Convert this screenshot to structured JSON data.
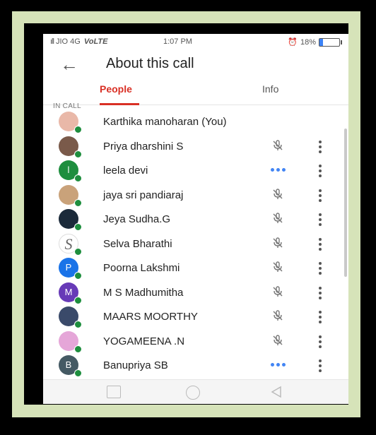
{
  "status_bar": {
    "carrier": "JIO 4G",
    "network_type": "VoLTE",
    "time": "1:07 PM",
    "battery": "18%"
  },
  "app_bar": {
    "title": "About this call",
    "back_icon": "arrow-back-icon"
  },
  "tabs": [
    {
      "label": "People",
      "active": true
    },
    {
      "label": "Info",
      "active": false
    }
  ],
  "section_label": "IN CALL",
  "participants": [
    {
      "name": "Karthika manoharan (You)",
      "avatar_color": "#e9b8a8",
      "avatar_letter": "",
      "status": "self"
    },
    {
      "name": "Priya dharshini S",
      "avatar_color": "#7a5a4a",
      "avatar_letter": "",
      "status": "muted"
    },
    {
      "name": "leela devi",
      "avatar_color": "#1e8e3e",
      "avatar_letter": "l",
      "status": "speaking"
    },
    {
      "name": "jaya sri pandiaraj",
      "avatar_color": "#c9a27a",
      "avatar_letter": "",
      "status": "muted"
    },
    {
      "name": "Jeya Sudha.G",
      "avatar_color": "#1b2a3a",
      "avatar_letter": "",
      "status": "muted"
    },
    {
      "name": "Selva Bharathi",
      "avatar_color": "#ffffff",
      "avatar_letter": "S",
      "status": "muted"
    },
    {
      "name": "Poorna Lakshmi",
      "avatar_color": "#1a73e8",
      "avatar_letter": "P",
      "status": "muted"
    },
    {
      "name": "M S Madhumitha",
      "avatar_color": "#673ab7",
      "avatar_letter": "M",
      "status": "muted"
    },
    {
      "name": "MAARS MOORTHY",
      "avatar_color": "#3a4a6a",
      "avatar_letter": "",
      "status": "muted"
    },
    {
      "name": "YOGAMEENA .N",
      "avatar_color": "#e5a6d8",
      "avatar_letter": "",
      "status": "muted"
    },
    {
      "name": "Banupriya SB",
      "avatar_color": "#455a64",
      "avatar_letter": "B",
      "status": "speaking"
    }
  ],
  "colors": {
    "accent": "#d93025",
    "online": "#1e8e3e",
    "speaking": "#4285f4",
    "frame": "#d6e3b9"
  },
  "icons": {
    "muted": "mic-off-icon",
    "speaking": "speaking-dots-icon",
    "more": "more-vert-icon"
  }
}
